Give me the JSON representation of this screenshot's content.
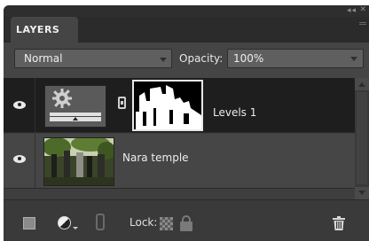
{
  "panel": {
    "tab_title": "LAYERS",
    "window_controls": {
      "collapse": "◂◂",
      "close": "✕"
    }
  },
  "controls": {
    "blend_mode": "Normal",
    "opacity_label": "Opacity:",
    "opacity_value": "100%"
  },
  "layers": [
    {
      "name": "Levels 1",
      "type": "adjustment",
      "visible": true,
      "selected": true,
      "has_mask": true
    },
    {
      "name": "Nara temple",
      "type": "photo",
      "visible": true,
      "selected": false
    }
  ],
  "toolbar": {
    "lock_label": "Lock:"
  },
  "icons": {
    "eye": "eye-icon",
    "gear": "gear-icon",
    "link": "link-icon",
    "new_layer": "new-layer-icon",
    "adjustment": "adjustment-layer-icon",
    "lock_transparency": "lock-transparency-icon",
    "lock_all": "lock-all-icon",
    "trash": "trash-icon"
  },
  "colors": {
    "panel_bg": "#454545",
    "selected_row": "#1e1e1e",
    "row_bg": "#464646",
    "text": "#e8e8e8"
  }
}
